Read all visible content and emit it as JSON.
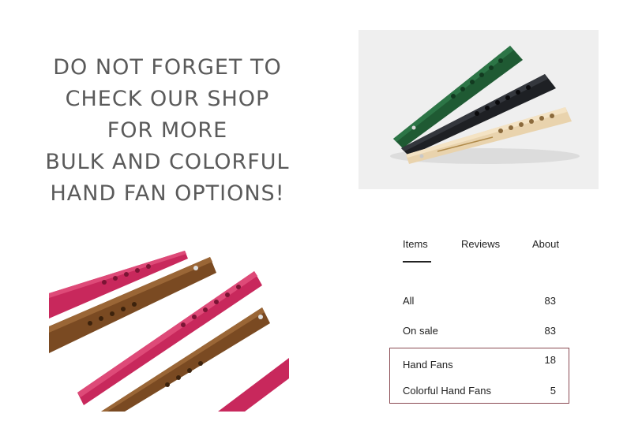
{
  "headline": {
    "lines": [
      "DO NOT FORGET TO",
      "CHECK OUR SHOP",
      "FOR MORE",
      "BULK AND COLORFUL",
      "HAND FAN OPTIONS!"
    ]
  },
  "images": {
    "top_photo": "green-black-natural-hand-fans-photo",
    "bottom_photo": "pink-brown-hand-fans-photo"
  },
  "tabs": [
    {
      "label": "Items",
      "active": true
    },
    {
      "label": "Reviews",
      "active": false
    },
    {
      "label": "About",
      "active": false
    }
  ],
  "categories": [
    {
      "label": "All",
      "count": "83"
    },
    {
      "label": "On sale",
      "count": "83"
    },
    {
      "label": "Hand Fans",
      "count": "18"
    },
    {
      "label": "Colorful Hand Fans",
      "count": "5"
    }
  ],
  "colors": {
    "headline": "#5a5a5a",
    "highlight_border": "#8a4a52",
    "fan_green": "#1f5a33",
    "fan_black": "#1e2024",
    "fan_natural": "#e9d3ad",
    "fan_pink": "#c8285c",
    "fan_brown": "#7a4a22"
  }
}
